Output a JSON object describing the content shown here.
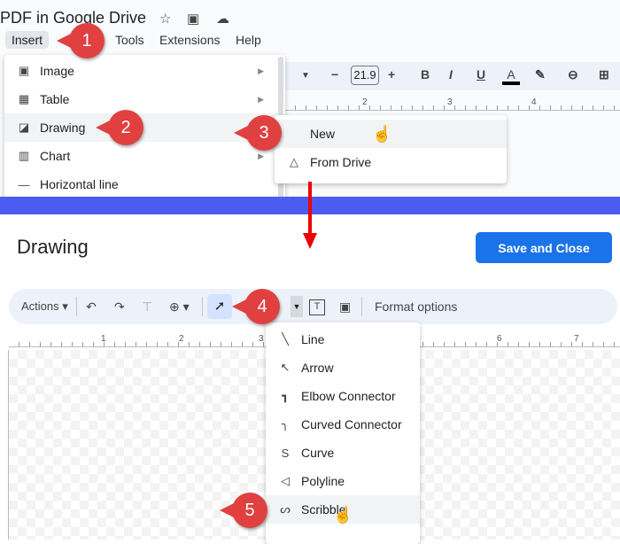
{
  "doc": {
    "title": "PDF in Google Drive",
    "menus": [
      "Insert",
      "Tools",
      "Extensions",
      "Help"
    ]
  },
  "insert_menu": {
    "items": [
      {
        "label": "Image",
        "icon": "image-icon",
        "submenu": true
      },
      {
        "label": "Table",
        "icon": "table-icon",
        "submenu": true
      },
      {
        "label": "Drawing",
        "icon": "drawing-icon",
        "submenu": true
      },
      {
        "label": "Chart",
        "icon": "chart-icon",
        "submenu": true
      },
      {
        "label": "Horizontal line",
        "icon": "horizontal-line-icon",
        "submenu": false
      }
    ]
  },
  "drawing_submenu": {
    "items": [
      {
        "label": "New"
      },
      {
        "label": "From Drive"
      }
    ]
  },
  "doc_toolbar": {
    "font_size": "21.9",
    "ruler": [
      "2",
      "3",
      "4"
    ]
  },
  "drawing": {
    "title": "Drawing",
    "save_label": "Save and Close",
    "actions_label": "Actions",
    "format_options": "Format options",
    "ruler": [
      "1",
      "2",
      "3",
      "5",
      "6",
      "7"
    ]
  },
  "line_menu": {
    "items": [
      "Line",
      "Arrow",
      "Elbow Connector",
      "Curved Connector",
      "Curve",
      "Polyline",
      "Scribble"
    ]
  },
  "callouts": [
    "1",
    "2",
    "3",
    "4",
    "5"
  ],
  "colors": {
    "accent": "#1a73e8",
    "callout": "#e04040",
    "band": "#4b5cf0"
  }
}
